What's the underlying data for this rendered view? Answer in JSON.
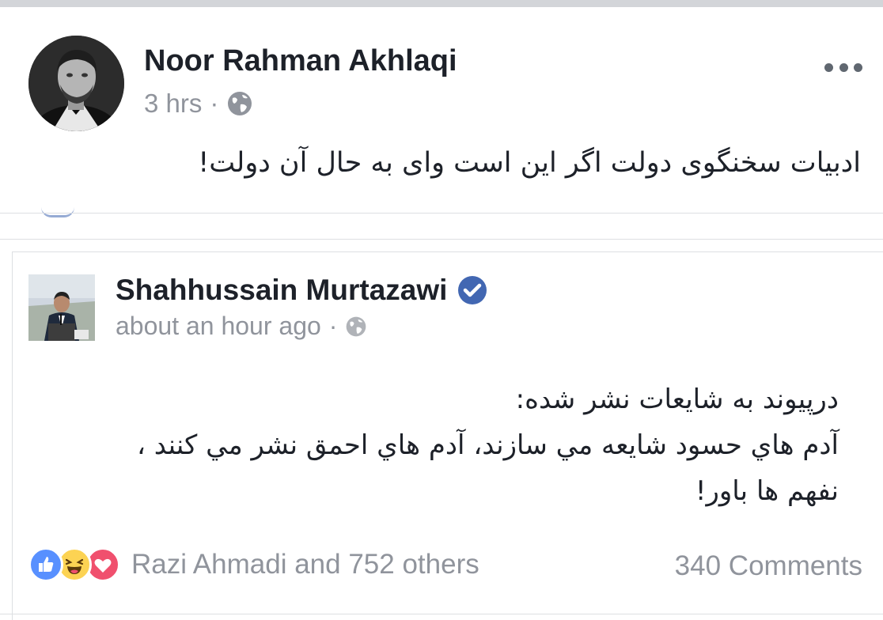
{
  "post": {
    "author": "Noor Rahman Akhlaqi",
    "time": "3 hrs",
    "separator": "·",
    "privacy_icon": "globe-icon",
    "more_icon": "more-horizontal-icon",
    "text": "ادبیات سخنگوی دولت اگر این است وای به حال آن دولت!"
  },
  "shared": {
    "author": "Shahhussain Murtazawi",
    "verified_icon": "verified-badge-icon",
    "time": "about an hour ago",
    "separator": "·",
    "privacy_icon": "globe-icon",
    "lines": [
      "درپيوند به شايعات نشر شده:",
      "آدم هاي حسود شايعه مي سازند، آدم هاي احمق نشر مي كنند ،",
      "نفهم ها باور!"
    ]
  },
  "reactions": {
    "icons": [
      "like-icon",
      "haha-icon",
      "love-icon"
    ],
    "summary": "Razi Ahmadi and 752 others",
    "comments": "340 Comments"
  },
  "colors": {
    "brand_blue": "#4267b2",
    "like_blue": "#5890ff",
    "haha_yellow": "#fcd353",
    "love_red": "#f0506e",
    "meta_gray": "#90949c",
    "text_dark": "#1d2129"
  }
}
